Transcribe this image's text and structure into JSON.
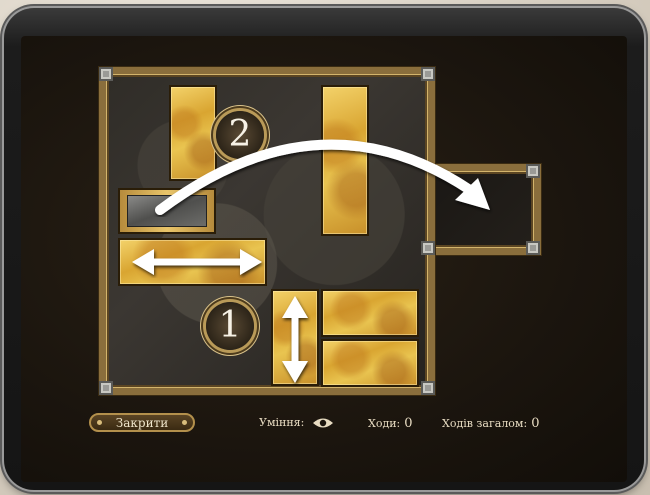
{
  "badges": {
    "move_one": "1",
    "move_two": "2"
  },
  "footer": {
    "close_label": "Закрити",
    "skill_label": "Уміння:",
    "skill_icon": "eye-icon",
    "moves_label": "Ходи:",
    "moves_value": "0",
    "total_moves_label": "Ходів загалом:",
    "total_moves_value": "0"
  },
  "colors": {
    "gold": "#d9a531",
    "frame": "#8a6e3c",
    "background": "#1b150e"
  }
}
